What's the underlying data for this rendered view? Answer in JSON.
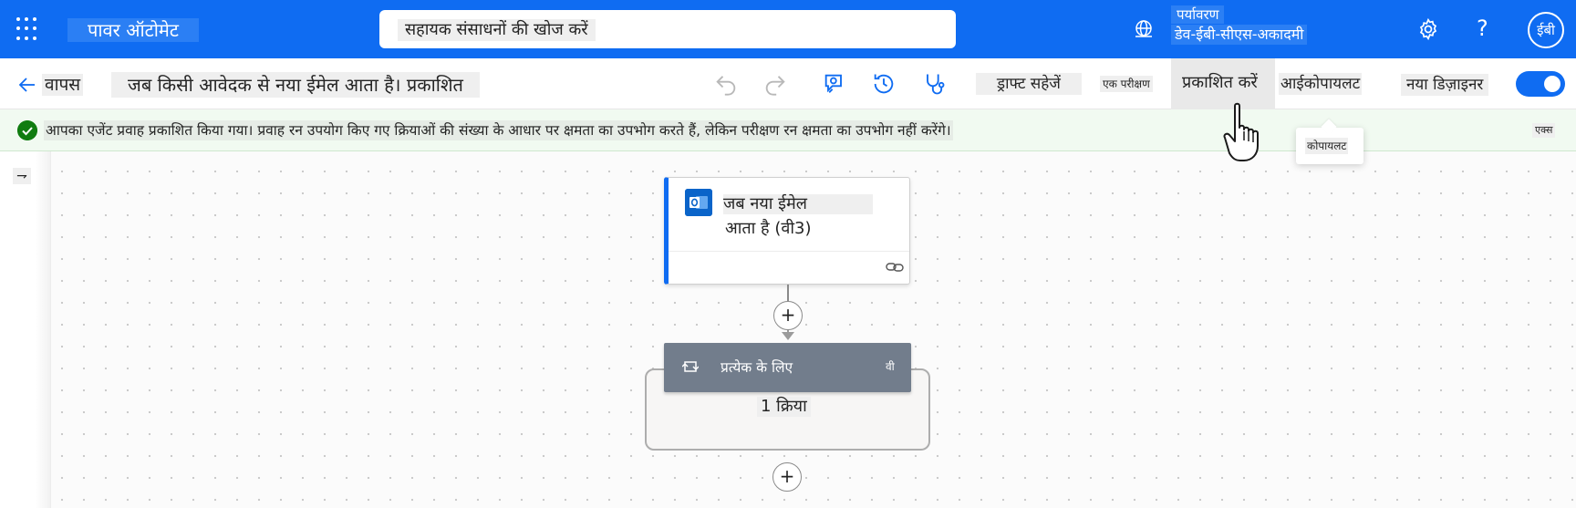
{
  "header": {
    "app_title": "पावर ऑटोमेट",
    "search_placeholder": "सहायक संसाधनों की खोज करें",
    "environment_label": "पर्यावरण",
    "environment_name": "डेव-ईबी-सीएस-अकादमी",
    "help_glyph": "?",
    "avatar_initials": "ईबी",
    "icons": [
      "app-launcher-icon",
      "environment-icon",
      "settings-icon",
      "help-icon"
    ]
  },
  "commandbar": {
    "back_label": "वापस",
    "flow_title": "जब किसी आवेदक से नया ईमेल आता है। प्रकाशित",
    "save_draft_label": "ड्राफ्ट सहेजें",
    "test_label": "एक परीक्षण",
    "publish_label": "प्रकाशित करें",
    "copilot_label": "आईकोपायलट",
    "new_designer_label": "नया डिज़ाइनर",
    "new_designer_on": true,
    "icons": [
      "undo-icon",
      "redo-icon",
      "flow-checker-icon",
      "version-history-icon",
      "health-icon"
    ]
  },
  "notification": {
    "message": "आपका एजेंट प्रवाह प्रकाशित किया गया। प्रवाह रन उपयोग किए गए क्रियाओं की संख्या के आधार पर क्षमता का उपभोग करते हैं, लेकिन परीक्षण रन क्षमता का उपभोग नहीं करेंगे।",
    "dismiss_label": "एक्स",
    "status_color": "#107c10"
  },
  "canvas": {
    "collapse_glyph": "⇁",
    "trigger": {
      "title_line1": "जब नया ईमेल",
      "title_line2": "आता है (वी3)",
      "icon": "outlook-icon"
    },
    "insert_step_glyph": "+",
    "foreach": {
      "title": "प्रत्येक के लिए",
      "badge": "वी",
      "action_count": "1 क्रिया"
    }
  },
  "tooltip": {
    "text": "कोपायलट"
  },
  "colors": {
    "brand_blue": "#0f6cf2",
    "foreach_header": "#727d8c",
    "success_green": "#107c10"
  }
}
